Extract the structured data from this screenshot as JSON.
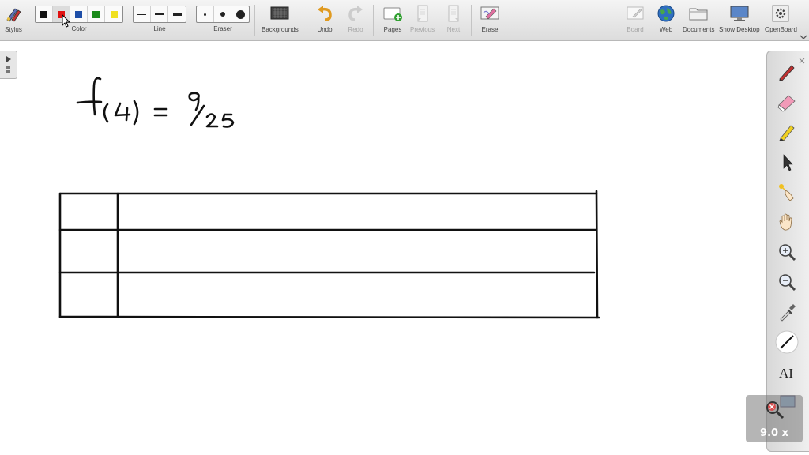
{
  "toolbar": {
    "stylus_label": "Stylus",
    "color_label": "Color",
    "line_label": "Line",
    "eraser_label": "Eraser",
    "backgrounds_label": "Backgrounds",
    "undo_label": "Undo",
    "redo_label": "Redo",
    "pages_label": "Pages",
    "previous_label": "Previous",
    "next_label": "Next",
    "erase_label": "Erase",
    "board_label": "Board",
    "web_label": "Web",
    "documents_label": "Documents",
    "show_desktop_label": "Show Desktop",
    "openboard_label": "OpenBoard",
    "colors": [
      "#111111",
      "#e01010",
      "#1f4fa8",
      "#1a8a1a",
      "#f0e020"
    ],
    "selected_color_index": 1
  },
  "canvas": {
    "handwriting": "f(4) = 9/25"
  },
  "palette": {
    "tools": [
      "pen-icon",
      "eraser-icon",
      "highlighter-icon",
      "pointer-icon",
      "laser-pointer-icon",
      "hand-icon",
      "zoom-in-icon",
      "zoom-out-icon",
      "color-picker-icon",
      "line-icon",
      "text-icon",
      "capture-icon"
    ]
  },
  "zoom": {
    "label": "9.0 x"
  }
}
